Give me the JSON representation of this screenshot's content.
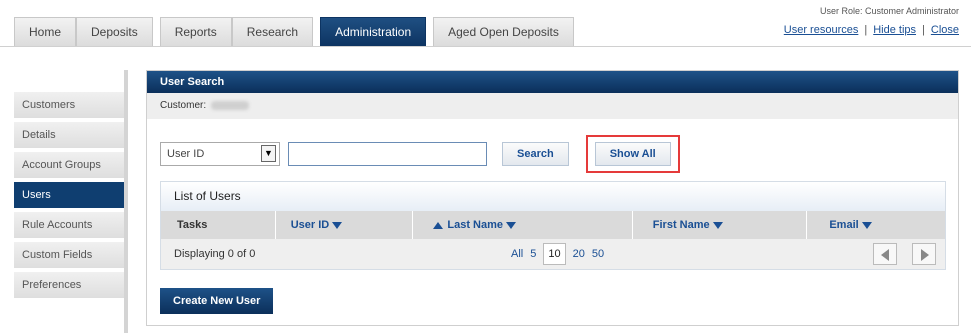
{
  "header": {
    "tab_groups": [
      [
        "Home",
        "Deposits"
      ],
      [
        "Reports",
        "Research"
      ],
      [
        "Administration"
      ],
      [
        "Aged Open Deposits"
      ]
    ],
    "active_tab": "Administration",
    "user_role": "User Role: Customer Administrator",
    "links": [
      "User resources",
      "Hide tips",
      "Close"
    ],
    "link_separator": "|"
  },
  "sidebar": {
    "items": [
      "Customers",
      "Details",
      "Account Groups",
      "Users",
      "Rule Accounts",
      "Custom Fields",
      "Preferences"
    ],
    "active": "Users"
  },
  "panel": {
    "title": "User Search",
    "customer_label": "Customer:",
    "search": {
      "field_select": "User ID",
      "input_value": "",
      "search_label": "Search",
      "show_all_label": "Show All"
    },
    "list": {
      "title": "List of Users",
      "columns": [
        "Tasks",
        "User ID",
        "Last Name",
        "First Name",
        "Email"
      ],
      "sorted_column": "Last Name",
      "sort_direction": "ascending",
      "display_text": "Displaying 0 of 0",
      "page_size_options": [
        "All",
        "5",
        "10",
        "20",
        "50"
      ],
      "page_size_selected": "10"
    },
    "create_label": "Create New User"
  },
  "colors": {
    "primary_navy": "#0f3e70",
    "link_blue": "#1a4f94",
    "highlight_red": "#e53a3a"
  }
}
